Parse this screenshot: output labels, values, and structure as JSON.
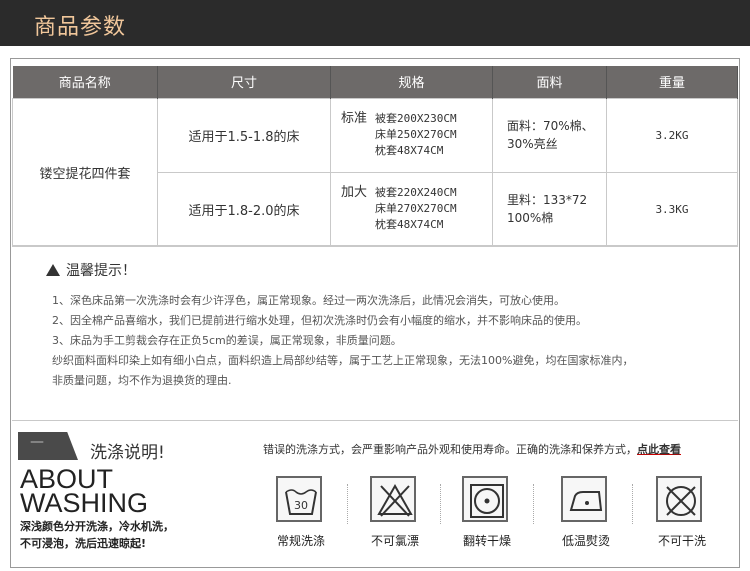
{
  "header": {
    "title": "商品参数"
  },
  "table": {
    "columns": [
      "商品名称",
      "尺寸",
      "规格",
      "面料",
      "重量"
    ],
    "product_name": "镂空提花四件套",
    "rows": [
      {
        "size": "适用于1.5-1.8的床",
        "spec_tag": "标准",
        "spec_lines": [
          "被套200X230CM",
          "床单250X270CM",
          "枕套48X74CM"
        ],
        "fabric": [
          "面料：70%棉、",
          "30%亮丝"
        ],
        "weight": "3.2KG"
      },
      {
        "size": "适用于1.8-2.0的床",
        "spec_tag": "加大",
        "spec_lines": [
          "被套220X240CM",
          "床单270X270CM",
          "枕套48X74CM"
        ],
        "fabric": [
          "里料：133*72",
          "100%棉"
        ],
        "weight": "3.3KG"
      }
    ]
  },
  "tips": {
    "title": "温馨提示！",
    "lines": [
      "1、深色床品第一次洗涤时会有少许浮色，属正常现象。经过一两次洗涤后，此情况会消失，可放心使用。",
      "2、因全棉产品喜缩水，我们已提前进行缩水处理，但初次洗涤时仍会有小幅度的缩水，并不影响床品的使用。",
      "3、床品为手工剪裁会存在正负5cm的差误，属正常现象，非质量问题。",
      "纱织面料面料印染上如有细小白点，面料织造上局部纱结等，属于工艺上正常现象，无法100%避免，均在国家标准内，",
      "非质量问题，均不作为退换货的理由."
    ]
  },
  "washing": {
    "banner_dash": "—",
    "title": "洗涤说明!",
    "note": "错误的洗涤方式，会严重影响产品外观和使用寿命。正确的洗涤和保养方式，",
    "link": "点此查看",
    "about_line1": "ABOUT",
    "about_line2": "WASHING",
    "sub_line1": "深浅颜色分开洗涤，冷水机洗，",
    "sub_line2": "不可浸泡，洗后迅速晾起!",
    "icons": [
      {
        "name": "wash-30-icon",
        "label": "常规洗涤",
        "text": "30"
      },
      {
        "name": "no-bleach-icon",
        "label": "不可氯漂"
      },
      {
        "name": "tumble-dry-icon",
        "label": "翻转干燥"
      },
      {
        "name": "low-iron-icon",
        "label": "低温熨烫"
      },
      {
        "name": "no-dry-clean-icon",
        "label": "不可干洗"
      }
    ]
  }
}
